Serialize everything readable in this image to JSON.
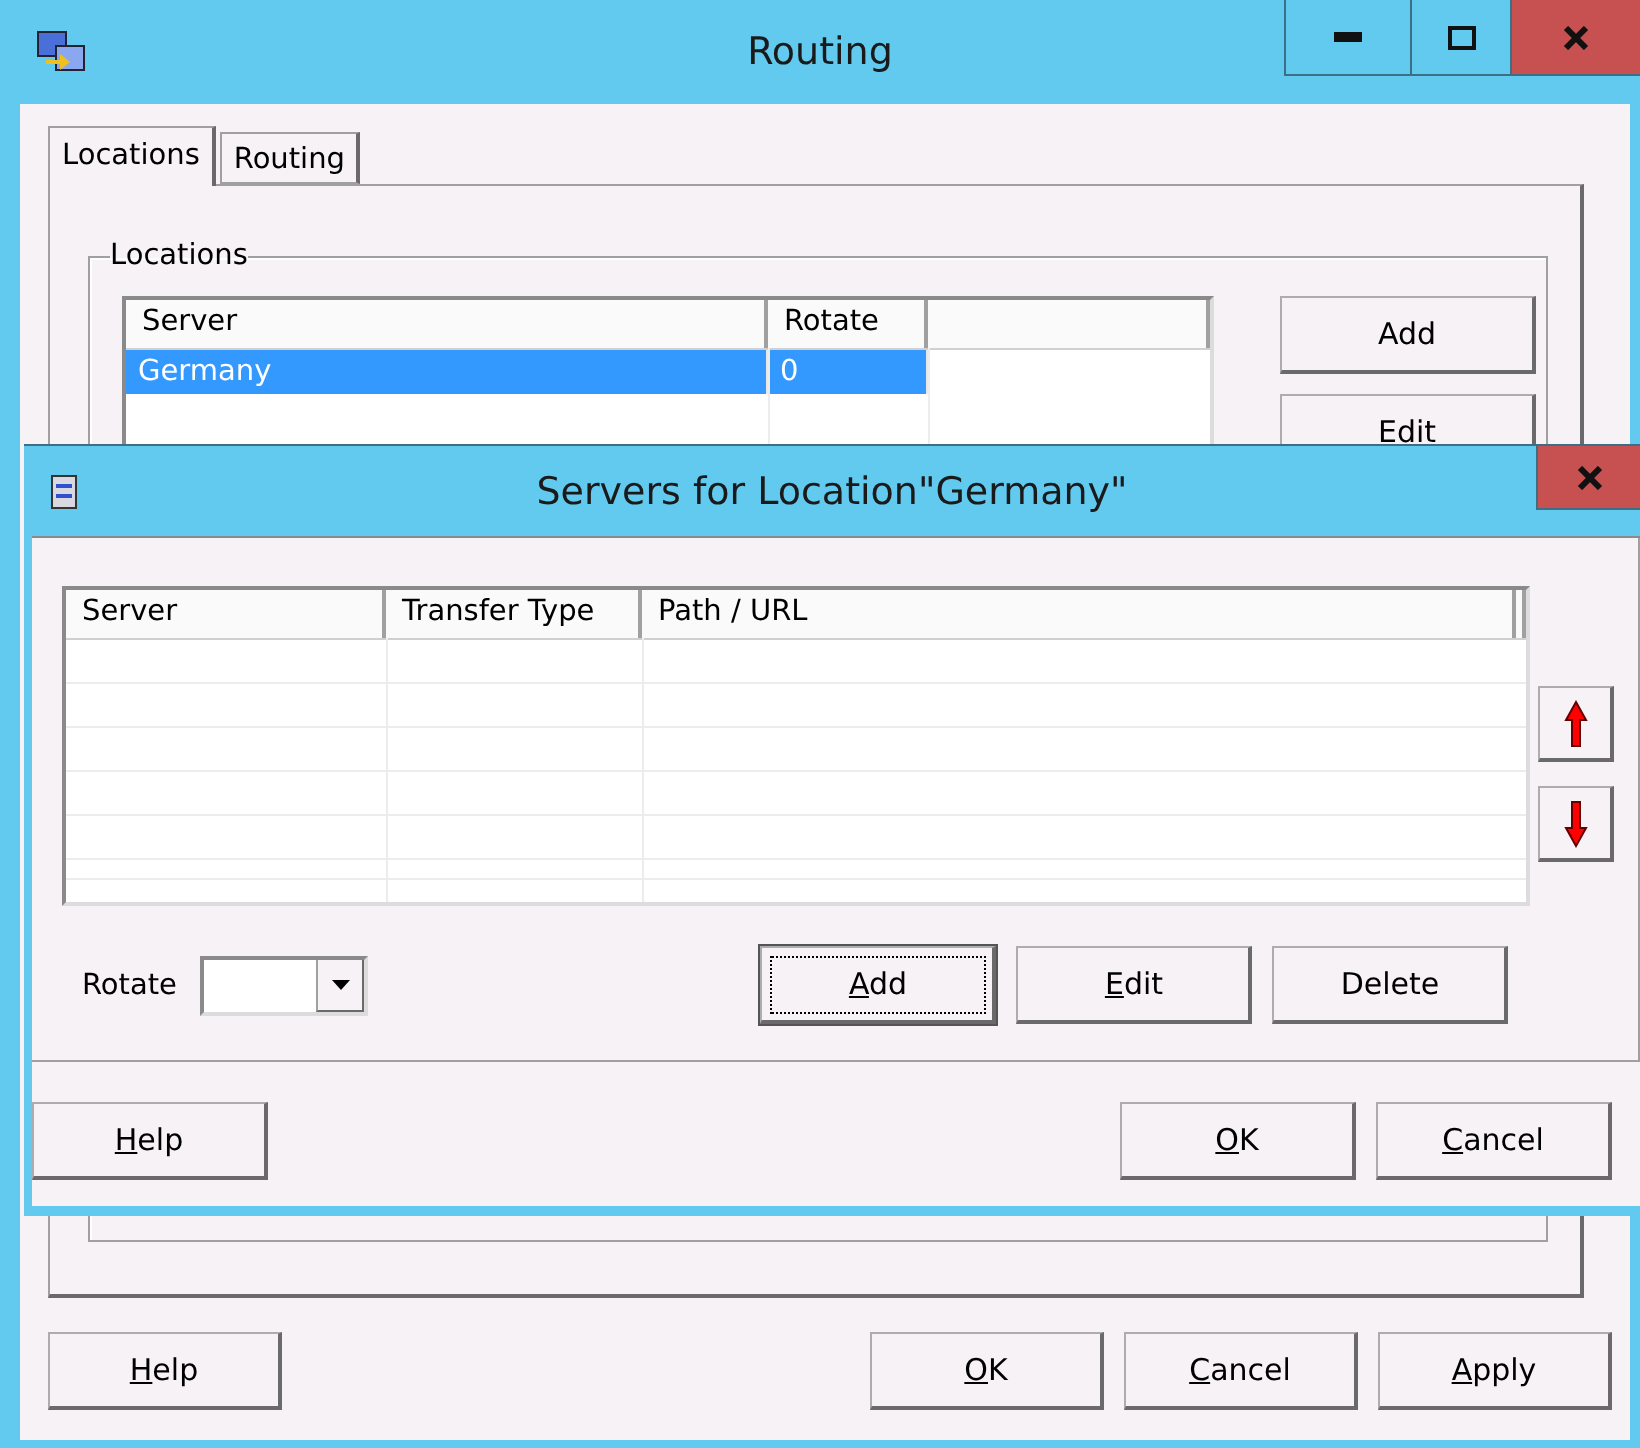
{
  "main_window": {
    "title": "Routing",
    "tabs": [
      {
        "label": "Locations",
        "selected": true
      },
      {
        "label": "Routing",
        "selected": false
      }
    ],
    "group": {
      "title": "Locations"
    },
    "table": {
      "columns": [
        "Server",
        "Rotate"
      ],
      "rows": [
        {
          "cells": [
            "Germany",
            "0"
          ],
          "selected": true
        }
      ]
    },
    "side_buttons": [
      {
        "label": "Add"
      },
      {
        "label": "Edit"
      }
    ],
    "buttons": [
      {
        "label": "Help",
        "mnemonic": true
      },
      {
        "label": "OK",
        "mnemonic": true
      },
      {
        "label": "Cancel",
        "mnemonic": true
      },
      {
        "label": "Apply",
        "mnemonic": true
      }
    ]
  },
  "dialog": {
    "title": "Servers for Location\"Germany\"",
    "table": {
      "columns": [
        "Server",
        "Transfer Type",
        "Path / URL"
      ]
    },
    "rotate": {
      "label": "Rotate"
    },
    "buttons": [
      {
        "label": "Add",
        "mnemonic": true,
        "focused": true
      },
      {
        "label": "Edit",
        "mnemonic": true,
        "focused": false
      },
      {
        "label": "Delete",
        "mnemonic": false,
        "focused": false
      }
    ],
    "footer_buttons": [
      {
        "label": "Help",
        "mnemonic": true
      },
      {
        "label": "OK",
        "mnemonic": true
      },
      {
        "label": "Cancel",
        "mnemonic": true
      }
    ]
  }
}
